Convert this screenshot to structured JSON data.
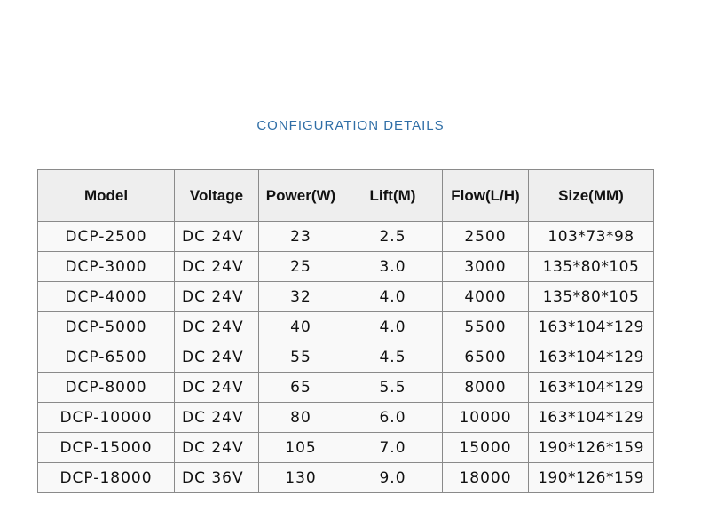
{
  "title": "CONFIGURATION DETAILS",
  "table": {
    "headers": [
      "Model",
      "Voltage",
      "Power(W)",
      "Lift(M)",
      "Flow(L/H)",
      "Size(MM)"
    ],
    "rows": [
      [
        "DCP-2500",
        "DC 24V",
        "23",
        "2.5",
        "2500",
        "103*73*98"
      ],
      [
        "DCP-3000",
        "DC 24V",
        "25",
        "3.0",
        "3000",
        "135*80*105"
      ],
      [
        "DCP-4000",
        "DC 24V",
        "32",
        "4.0",
        "4000",
        "135*80*105"
      ],
      [
        "DCP-5000",
        "DC 24V",
        "40",
        "4.0",
        "5500",
        "163*104*129"
      ],
      [
        "DCP-6500",
        "DC 24V",
        "55",
        "4.5",
        "6500",
        "163*104*129"
      ],
      [
        "DCP-8000",
        "DC 24V",
        "65",
        "5.5",
        "8000",
        "163*104*129"
      ],
      [
        "DCP-10000",
        "DC 24V",
        "80",
        "6.0",
        "10000",
        "163*104*129"
      ],
      [
        "DCP-15000",
        "DC 24V",
        "105",
        "7.0",
        "15000",
        "190*126*159"
      ],
      [
        "DCP-18000",
        "DC 36V",
        "130",
        "9.0",
        "18000",
        "190*126*159"
      ]
    ]
  },
  "colors": {
    "title": "#2f6ea6",
    "header_bg": "#eeeeee",
    "border": "#8a8a8a"
  }
}
